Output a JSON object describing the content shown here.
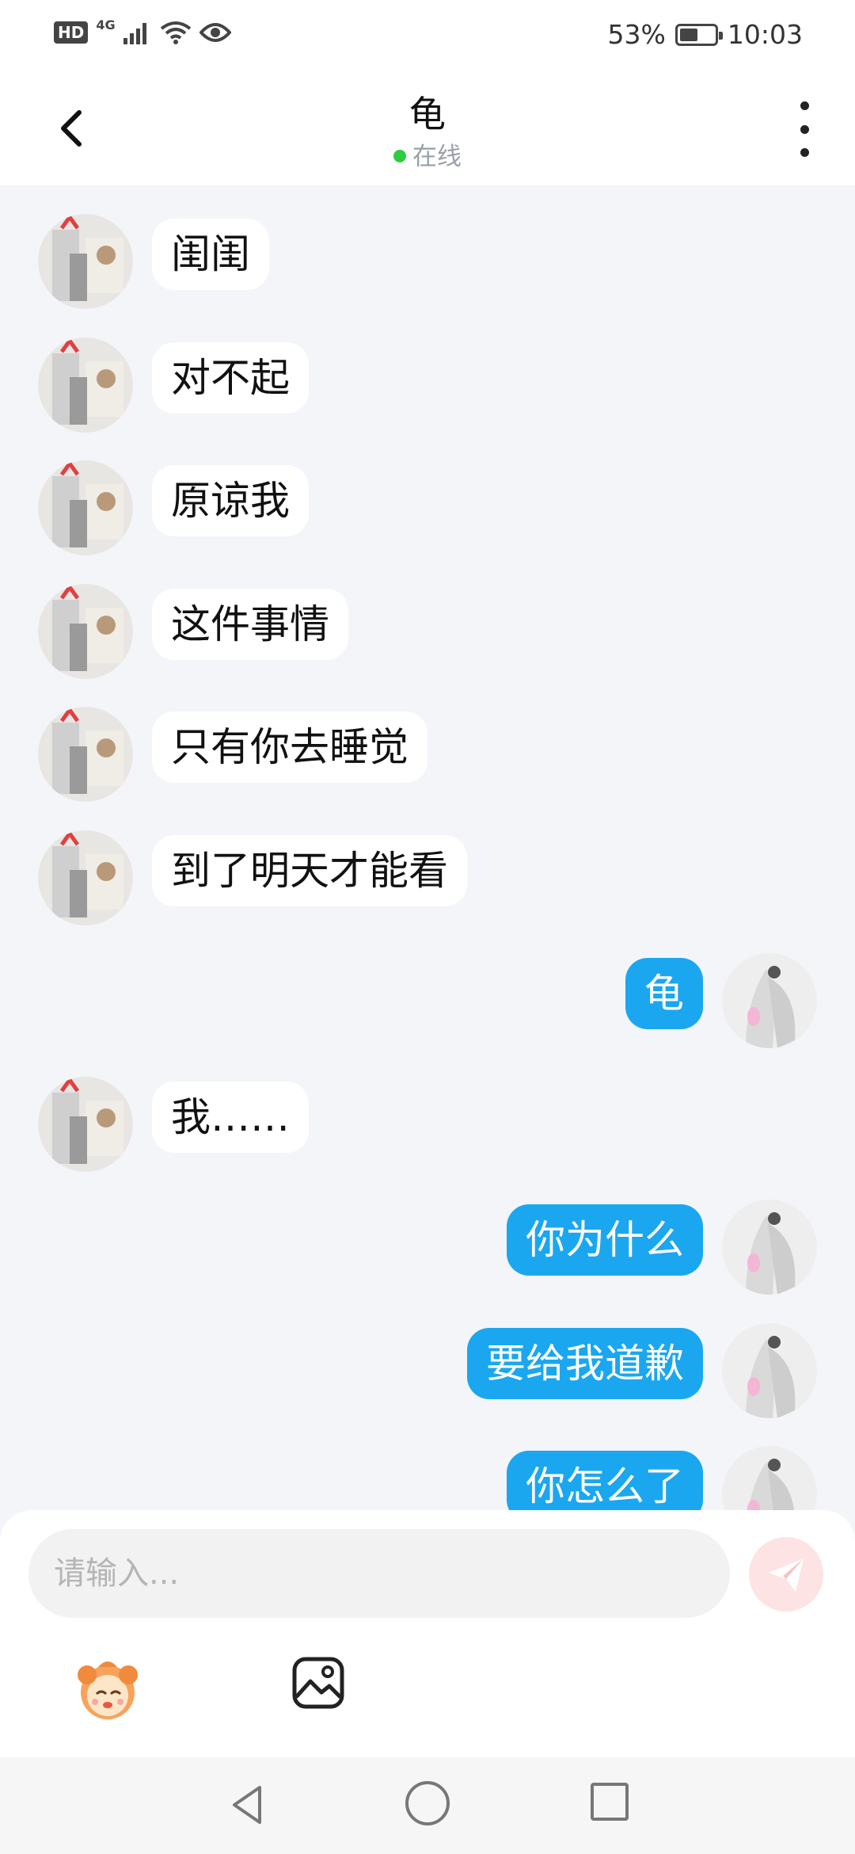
{
  "status_bar": {
    "network_badge": "HD",
    "network_type": "4G",
    "battery_percent": "53%",
    "battery_level": 0.53,
    "time": "10:03"
  },
  "header": {
    "title": "龟",
    "status": "在线",
    "back_icon": "chevron-left-icon",
    "more_icon": "more-vertical-icon"
  },
  "messages": [
    {
      "side": "left",
      "text": "闺闺"
    },
    {
      "side": "left",
      "text": "对不起"
    },
    {
      "side": "left",
      "text": "原谅我"
    },
    {
      "side": "left",
      "text": "这件事情"
    },
    {
      "side": "left",
      "text": "只有你去睡觉"
    },
    {
      "side": "left",
      "text": "到了明天才能看"
    },
    {
      "side": "right",
      "text": "龟"
    },
    {
      "side": "left",
      "text": "我……"
    },
    {
      "side": "right",
      "text": "你为什么"
    },
    {
      "side": "right",
      "text": "要给我道歉"
    },
    {
      "side": "right",
      "text": "你怎么了"
    }
  ],
  "composer": {
    "placeholder": "请输入...",
    "value": "",
    "send_icon": "paper-plane-icon",
    "emoji_icon": "mascot-emoji-icon",
    "image_icon": "image-icon"
  },
  "colors": {
    "accent": "#1aa7f0",
    "online": "#2ecc40",
    "send_disabled": "#fde3e3",
    "background": "#f3f5f8"
  }
}
